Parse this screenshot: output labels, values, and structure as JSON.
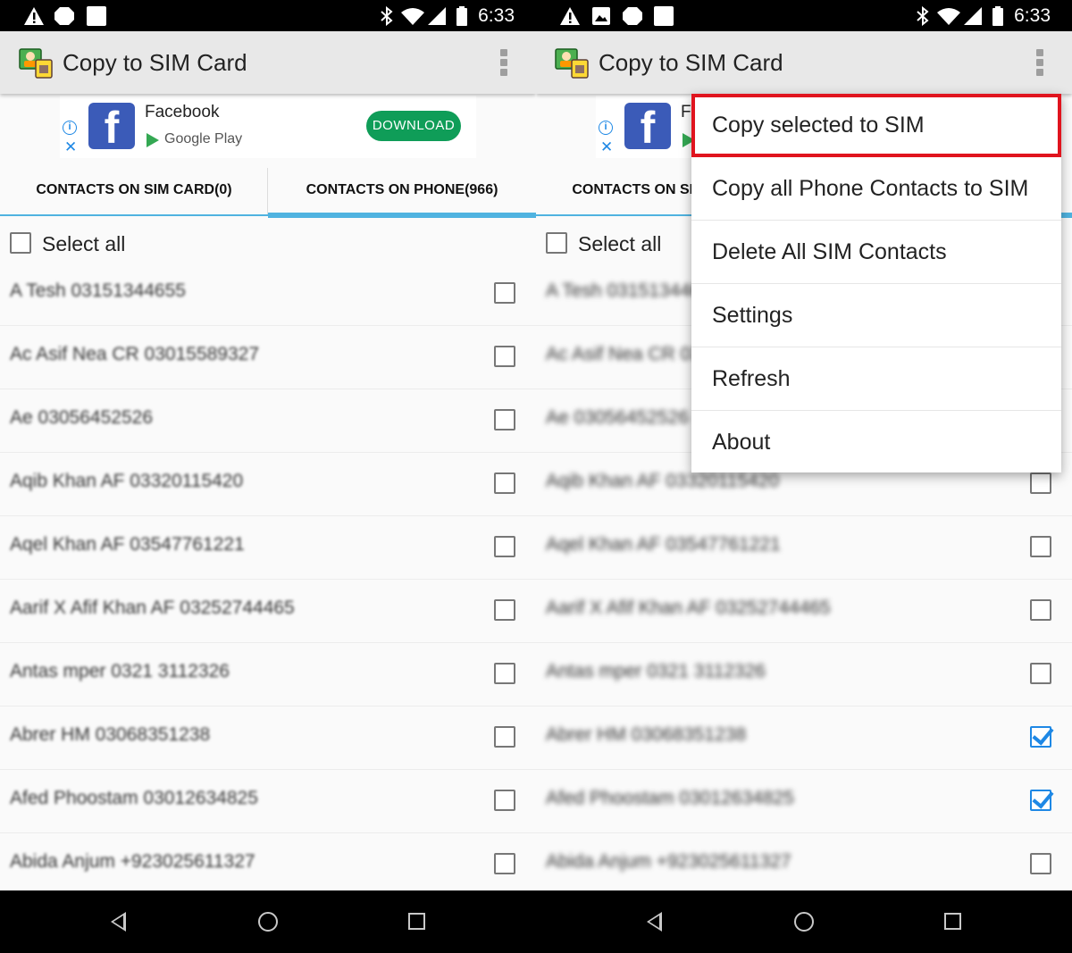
{
  "status_bar": {
    "time": "6:33"
  },
  "app_bar": {
    "title": "Copy to SIM Card"
  },
  "ad": {
    "app_name": "Facebook",
    "store": "Google Play",
    "logo_letter": "f",
    "download_label": "DOWNLOAD",
    "info_glyph": "i",
    "close_glyph": "✕"
  },
  "tabs": [
    {
      "label": "CONTACTS ON SIM CARD(0)"
    },
    {
      "label": "CONTACTS ON PHONE(966)"
    }
  ],
  "select_all_label": "Select all",
  "contacts": [
    {
      "name": "A Tesh  03151344655",
      "checked_right": false
    },
    {
      "name": "Ac Asif Nea CR  03015589327",
      "checked_right": false
    },
    {
      "name": "Ae  03056452526",
      "checked_right": false
    },
    {
      "name": "Aqib Khan AF  03320115420",
      "checked_right": false
    },
    {
      "name": "Aqel Khan AF  03547761221",
      "checked_right": false
    },
    {
      "name": "Aarif X Afif Khan AF  03252744465",
      "checked_right": false
    },
    {
      "name": "Antas mper  0321 3112326",
      "checked_right": false
    },
    {
      "name": "Abrer HM  03068351238",
      "checked_right": true
    },
    {
      "name": "Afed Phoostam  03012634825",
      "checked_right": true
    },
    {
      "name": "Abida Anjum  +923025611327",
      "checked_right": false
    }
  ],
  "menu": {
    "items": [
      {
        "label": "Copy selected to SIM"
      },
      {
        "label": "Copy all Phone Contacts to SIM"
      },
      {
        "label": "Delete All SIM Contacts"
      },
      {
        "label": "Settings"
      },
      {
        "label": "Refresh"
      },
      {
        "label": "About"
      }
    ],
    "highlight_color": "#e0141e"
  },
  "colors": {
    "accent": "#4fb3e0",
    "check": "#1e88e5",
    "download_bg": "#0f9d58"
  }
}
